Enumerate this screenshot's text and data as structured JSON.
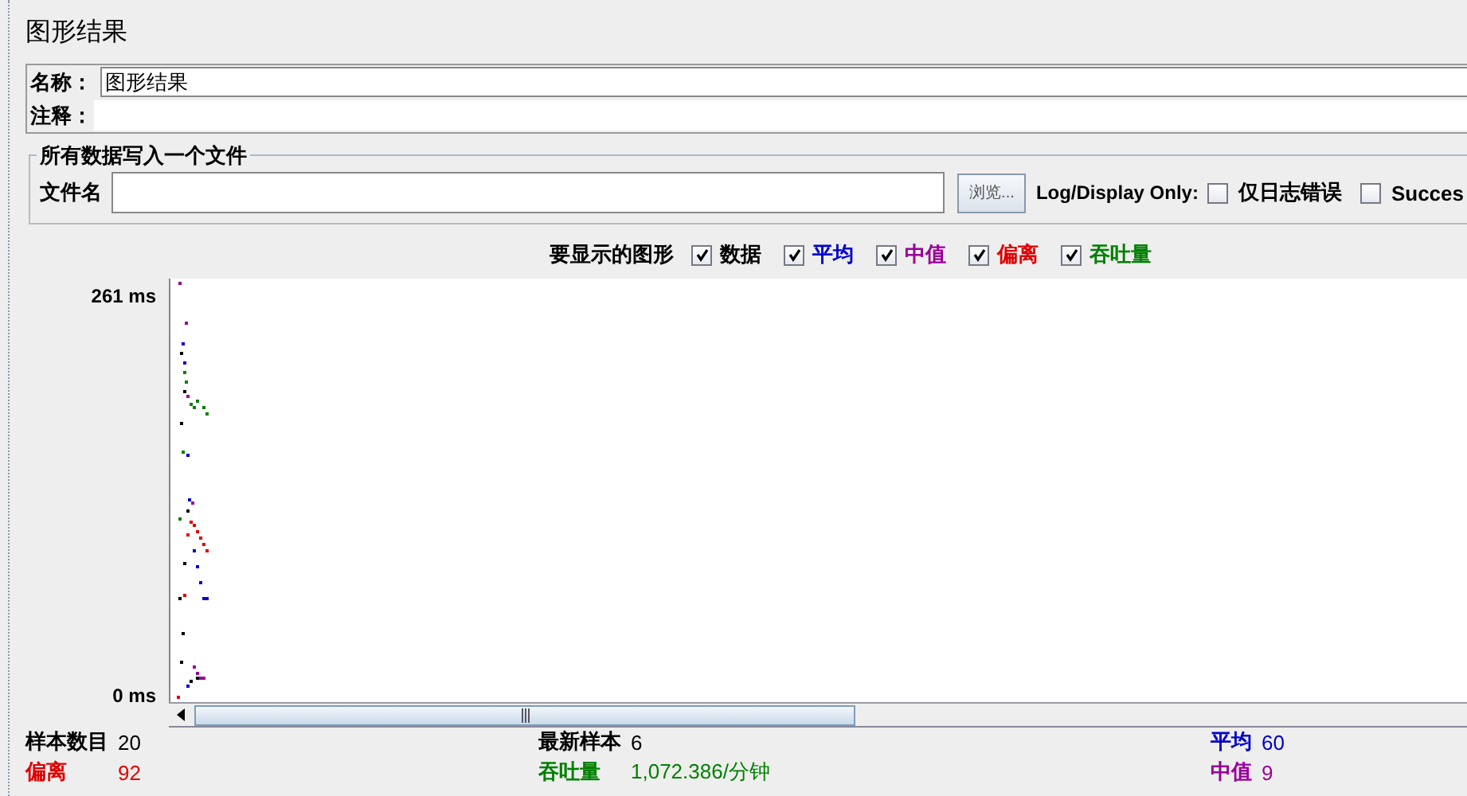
{
  "title": "图形结果",
  "name_field": {
    "label": "名称：",
    "value": "图形结果"
  },
  "comment_field": {
    "label": "注释："
  },
  "file_group": {
    "legend": "所有数据写入一个文件",
    "label": "文件名",
    "browse_button": "浏览...",
    "log_label": "Log/Display Only:",
    "options": [
      {
        "label": "仅日志错误",
        "checked": false
      },
      {
        "label": "Succes",
        "checked": false
      }
    ]
  },
  "graphs": {
    "label": "要显示的图形",
    "items": [
      {
        "label": "数据",
        "checked": true,
        "color": "#000000"
      },
      {
        "label": "平均",
        "checked": true,
        "color": "#0000cc"
      },
      {
        "label": "中值",
        "checked": true,
        "color": "#990099"
      },
      {
        "label": "偏离",
        "checked": true,
        "color": "#e00000"
      },
      {
        "label": "吞吐量",
        "checked": true,
        "color": "#008000"
      }
    ]
  },
  "chart": {
    "y_max_label": "261 ms",
    "y_min_label": "0 ms"
  },
  "stats": [
    {
      "label": "样本数目",
      "value": "20",
      "color": "#000000"
    },
    {
      "label": "最新样本",
      "value": "6",
      "color": "#000000"
    },
    {
      "label": "平均",
      "value": "60",
      "color": "#0000cc"
    },
    {
      "label": "偏离",
      "value": "92",
      "color": "#e00000"
    },
    {
      "label": "吞吐量",
      "value": "1,072.386/分钟",
      "color": "#008000"
    },
    {
      "label": "中值",
      "value": "9",
      "color": "#990099"
    }
  ]
}
